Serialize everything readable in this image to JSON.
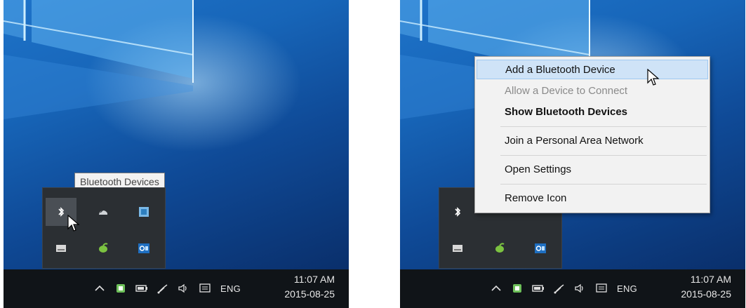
{
  "left_panel": {
    "tooltip": "Bluetooth Devices",
    "tray_icons": [
      "bluetooth-icon",
      "network-cloud-icon",
      "app-tile-icon",
      "drive-icon",
      "green-app-icon",
      "outlook-icon"
    ],
    "taskbar": {
      "language": "ENG",
      "time": "11:07 AM",
      "date": "2015-08-25"
    }
  },
  "right_panel": {
    "context_menu": {
      "items": [
        {
          "label": "Add a Bluetooth Device",
          "state": "highlighted"
        },
        {
          "label": "Allow a Device to Connect",
          "state": "disabled"
        },
        {
          "label": "Show Bluetooth Devices",
          "state": "bold"
        },
        {
          "label": "Join a Personal Area Network",
          "state": "normal"
        },
        {
          "label": "Open Settings",
          "state": "normal"
        },
        {
          "label": "Remove Icon",
          "state": "normal"
        }
      ]
    },
    "taskbar": {
      "language": "ENG",
      "time": "11:07 AM",
      "date": "2015-08-25"
    }
  },
  "colors": {
    "menu_highlight": "#cfe3f7",
    "taskbar": "#101418",
    "desktop": "#1765b8"
  }
}
